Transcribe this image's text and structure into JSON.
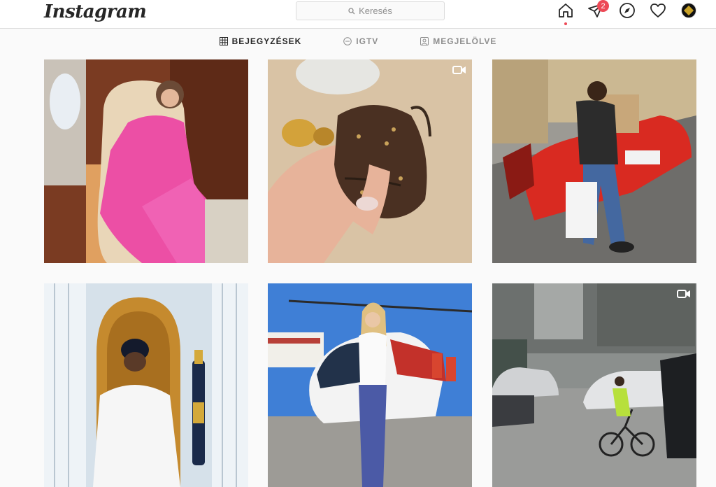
{
  "app": {
    "logo_text": "Instagram"
  },
  "search": {
    "placeholder": "Keresés"
  },
  "nav": {
    "activity_badge": "2",
    "accent": "#ed4956"
  },
  "tabs": [
    {
      "label": "BEJEGYZÉSEK",
      "icon": "grid-icon",
      "active": true
    },
    {
      "label": "IGTV",
      "icon": "igtv-icon",
      "active": false
    },
    {
      "label": "MEGJELÖLVE",
      "icon": "tagged-icon",
      "active": false
    }
  ],
  "posts": [
    {
      "description": "woman in pink tracksuit on private jet",
      "video": false
    },
    {
      "description": "hand holding mini monogram backpack charm",
      "video": true
    },
    {
      "description": "man with red sports car and shopping bag",
      "video": false
    },
    {
      "description": "man in TMT cap with champagne bottle",
      "video": false
    },
    {
      "description": "woman in front of helicopter",
      "video": false
    },
    {
      "description": "city street with cyclist",
      "video": true
    }
  ]
}
